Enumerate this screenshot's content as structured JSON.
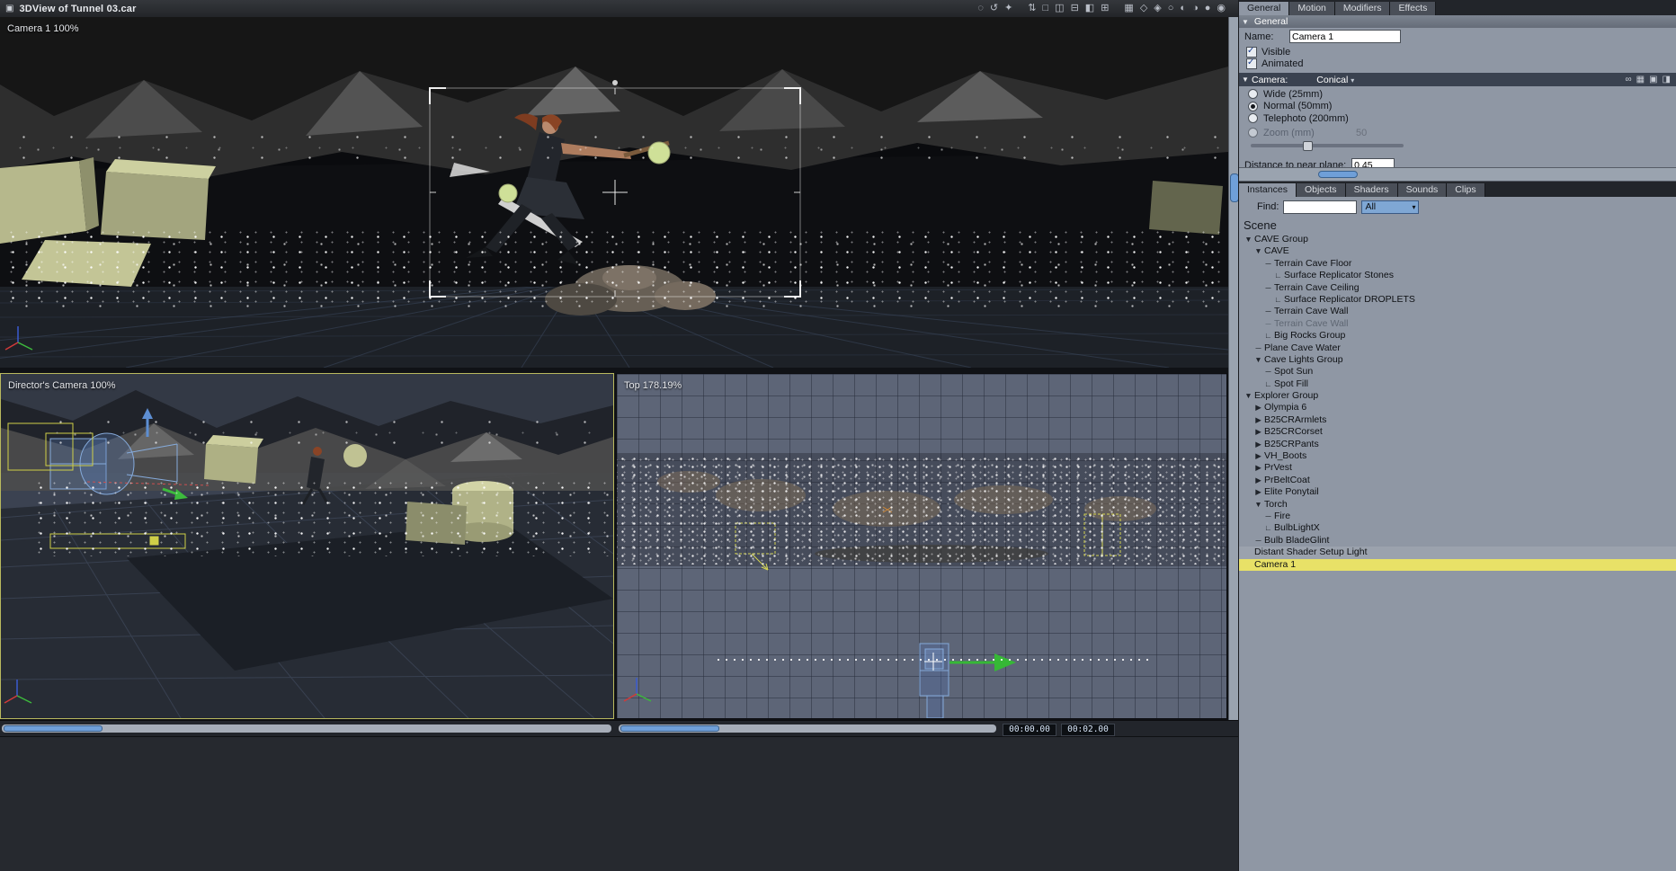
{
  "colors": {
    "selection_yellow": "#e8e167",
    "scroll_blue": "#6f9fd8",
    "panel_gray": "#8f97a4",
    "active_border_yellow": "#b9b95e"
  },
  "titlebar": {
    "window_icon": "▣",
    "title": "3DView of Tunnel 03.car",
    "icons": [
      {
        "name": "magnifier-tool-icon",
        "glyph": "◌"
      },
      {
        "name": "rotate-view-icon",
        "glyph": "↺"
      },
      {
        "name": "pan-view-icon",
        "glyph": "✦"
      },
      {
        "name": "dolly-view-icon",
        "glyph": "⇅"
      },
      {
        "name": "layout-single-icon",
        "glyph": "□"
      },
      {
        "name": "layout-two-vertical-icon",
        "glyph": "◫"
      },
      {
        "name": "layout-two-horizontal-icon",
        "glyph": "⊟"
      },
      {
        "name": "layout-three-icon",
        "glyph": "◧"
      },
      {
        "name": "layout-four-icon",
        "glyph": "⊞"
      },
      {
        "name": "layout-grid-icon",
        "glyph": "▦"
      },
      {
        "name": "display-box-icon",
        "glyph": "◇"
      },
      {
        "name": "display-wireframe-icon",
        "glyph": "◈"
      },
      {
        "name": "display-flat-icon",
        "glyph": "○"
      },
      {
        "name": "display-gouraud-icon",
        "glyph": "◐"
      },
      {
        "name": "display-phong-icon",
        "glyph": "◑"
      },
      {
        "name": "display-textured-icon",
        "glyph": "●"
      },
      {
        "name": "render-preview-icon",
        "glyph": "◉"
      }
    ]
  },
  "viewports": {
    "main": {
      "label": "Camera 1 100%"
    },
    "director": {
      "label": "Director's Camera 100%"
    },
    "top": {
      "label": "Top 178.19%"
    }
  },
  "properties": {
    "tabs": [
      {
        "name": "tab-general",
        "label": "General",
        "state": "active"
      },
      {
        "name": "tab-motion",
        "label": "Motion"
      },
      {
        "name": "tab-modifiers",
        "label": "Modifiers"
      },
      {
        "name": "tab-effects",
        "label": "Effects"
      }
    ],
    "general": {
      "header": "General",
      "name_label": "Name:",
      "name_value": "Camera 1",
      "visible_label": "Visible",
      "animated_label": "Animated"
    },
    "camera": {
      "header": "Camera:",
      "type_value": "Conical",
      "header_icons": [
        {
          "name": "link-icon",
          "glyph": "∞"
        },
        {
          "name": "grid-snap-icon",
          "glyph": "▦"
        },
        {
          "name": "solo-view-icon",
          "glyph": "▣"
        },
        {
          "name": "split-view-icon",
          "glyph": "◨"
        }
      ],
      "options": [
        {
          "name": "radio-wide",
          "label": "Wide (25mm)"
        },
        {
          "name": "radio-normal",
          "label": "Normal (50mm)",
          "state": "selected"
        },
        {
          "name": "radio-telephoto",
          "label": "Telephoto (200mm)"
        }
      ],
      "zoom_label": "Zoom (mm)",
      "zoom_value": "50",
      "near_plane_label": "Distance to near plane:",
      "near_plane_value": "0.45"
    }
  },
  "browser": {
    "tabs": [
      {
        "name": "tab-instances",
        "label": "Instances",
        "state": "active"
      },
      {
        "name": "tab-objects",
        "label": "Objects"
      },
      {
        "name": "tab-shaders",
        "label": "Shaders"
      },
      {
        "name": "tab-sounds",
        "label": "Sounds"
      },
      {
        "name": "tab-clips",
        "label": "Clips"
      }
    ],
    "find_label": "Find:",
    "find_value": "",
    "filter_value": "All",
    "scene_title": "Scene",
    "tree": [
      {
        "name": "tree-item-cave-group",
        "label": "CAVE Group",
        "glyph": "▼",
        "indent": 0
      },
      {
        "name": "tree-item-cave",
        "label": "CAVE",
        "glyph": "▼",
        "indent": 1
      },
      {
        "name": "tree-item-terrain-cave-floor",
        "label": "Terrain Cave Floor",
        "glyph": "─",
        "indent": 2
      },
      {
        "name": "tree-item-surface-replicator-stones",
        "label": "Surface Replicator Stones",
        "glyph": "∟",
        "indent": 3
      },
      {
        "name": "tree-item-terrain-cave-ceiling",
        "label": "Terrain Cave Ceiling",
        "glyph": "─",
        "indent": 2
      },
      {
        "name": "tree-item-surface-replicator-droplets",
        "label": "Surface Replicator DROPLETS",
        "glyph": "∟",
        "indent": 3
      },
      {
        "name": "tree-item-terrain-cave-wall",
        "label": "Terrain Cave Wall",
        "glyph": "─",
        "indent": 2
      },
      {
        "name": "tree-item-terrain-cave-wall-2",
        "label": "Terrain Cave Wall",
        "glyph": "─",
        "indent": 2,
        "state": "dimmed"
      },
      {
        "name": "tree-item-big-rocks-group",
        "label": "Big Rocks Group",
        "glyph": "∟",
        "indent": 2
      },
      {
        "name": "tree-item-plane-cave-water",
        "label": "Plane Cave Water",
        "glyph": "─",
        "indent": 1
      },
      {
        "name": "tree-item-cave-lights-group",
        "label": "Cave Lights Group",
        "glyph": "▼",
        "indent": 1
      },
      {
        "name": "tree-item-spot-sun",
        "label": "Spot Sun",
        "glyph": "─",
        "indent": 2
      },
      {
        "name": "tree-item-spot-fill",
        "label": "Spot Fill",
        "glyph": "∟",
        "indent": 2
      },
      {
        "name": "tree-item-explorer-group",
        "label": "Explorer Group",
        "glyph": "▼",
        "indent": 0
      },
      {
        "name": "tree-item-olympia-6",
        "label": "Olympia 6",
        "glyph": "▶",
        "indent": 1
      },
      {
        "name": "tree-item-b25crarmlets",
        "label": "B25CRArmlets",
        "glyph": "▶",
        "indent": 1
      },
      {
        "name": "tree-item-b25crcorset",
        "label": "B25CRCorset",
        "glyph": "▶",
        "indent": 1
      },
      {
        "name": "tree-item-b25crpants",
        "label": "B25CRPants",
        "glyph": "▶",
        "indent": 1
      },
      {
        "name": "tree-item-vh-boots",
        "label": "VH_Boots",
        "glyph": "▶",
        "indent": 1
      },
      {
        "name": "tree-item-prvest",
        "label": "PrVest",
        "glyph": "▶",
        "indent": 1
      },
      {
        "name": "tree-item-prbeltcoat",
        "label": "PrBeltCoat",
        "glyph": "▶",
        "indent": 1
      },
      {
        "name": "tree-item-elite-ponytail",
        "label": "Elite Ponytail",
        "glyph": "▶",
        "indent": 1
      },
      {
        "name": "tree-item-torch",
        "label": "Torch",
        "glyph": "▼",
        "indent": 1
      },
      {
        "name": "tree-item-fire",
        "label": "Fire",
        "glyph": "─",
        "indent": 2
      },
      {
        "name": "tree-item-bulblightx",
        "label": "BulbLightX",
        "glyph": "∟",
        "indent": 2
      },
      {
        "name": "tree-item-bulb-bladeglint",
        "label": "Bulb BladeGlint",
        "glyph": "─",
        "indent": 1
      },
      {
        "name": "tree-item-distant-shader-setup-light",
        "label": "Distant Shader Setup Light",
        "glyph": "",
        "indent": 0,
        "state": "band"
      },
      {
        "name": "tree-item-camera-1",
        "label": "Camera 1",
        "glyph": "",
        "indent": 0,
        "state": "selected"
      }
    ]
  },
  "footer": {
    "time_current": "00:00.00",
    "time_end": "00:02.00"
  }
}
